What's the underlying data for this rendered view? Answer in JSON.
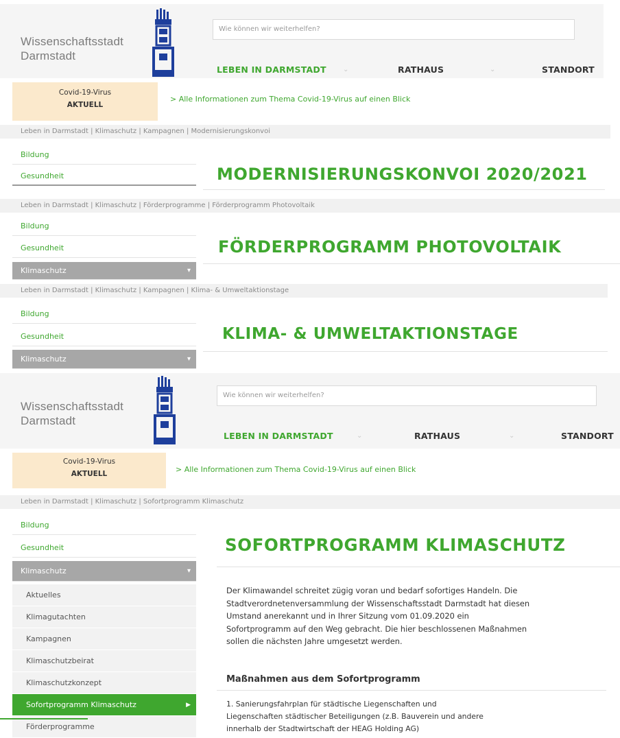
{
  "header": {
    "brand_line1": "Wissenschaftsstadt",
    "brand_line2": "Darmstadt",
    "search_placeholder": "Wie können wir weiterhelfen?",
    "nav": [
      "LEBEN IN DARMSTADT",
      "RATHAUS",
      "STANDORT"
    ]
  },
  "covid": {
    "label_line1": "Covid-19-Virus",
    "label_line2": "AKTUELL",
    "link_text": "> Alle Informationen zum Thema Covid-19-Virus auf einen Blick"
  },
  "panels": {
    "konvoi": {
      "breadcrumb": "Leben in Darmstadt | Klimaschutz | Kampagnen | Modernisierungskonvoi",
      "title": "MODERNISIERUNGSKONVOI 2020/2021"
    },
    "photovoltaik": {
      "breadcrumb": "Leben in Darmstadt | Klimaschutz | Förderprogramme | Förderprogramm Photovoltaik",
      "title": "FÖRDERPROGRAMM PHOTOVOLTAIK"
    },
    "aktionstage": {
      "breadcrumb": "Leben in Darmstadt | Klimaschutz | Kampagnen | Klima- & Umweltaktionstage",
      "title": "KLIMA- & UMWELTAKTIONSTAGE"
    },
    "sofort": {
      "breadcrumb": "Leben in Darmstadt | Klimaschutz | Sofortprogramm Klimaschutz",
      "title": "SOFORTPROGRAMM KLIMASCHUTZ",
      "body_line1": "Der Klimawandel schreitet zügig voran und bedarf sofortiges Handeln. Die",
      "body_line2": "Stadtverordnetenversammlung der Wissenschaftsstadt Darmstadt hat diesen",
      "body_line3": "Umstand anerekannt und in Ihrer Sitzung vom 01.09.2020 ein",
      "body_line4": "Sofortprogramm auf den Weg gebracht. Die hier beschlossenen Maßnahmen",
      "body_line5": "sollen die nächsten Jahre umgesetzt werden.",
      "subheading": "Maßnahmen aus dem Sofortprogramm",
      "item1_line1": "1. Sanierungsfahrplan für städtische Liegenschaften und",
      "item1_line2": "Liegenschaften städtischer Beteiligungen (z.B. Bauverein und andere",
      "item1_line3": "innerhalb der Stadtwirtschaft der HEAG Holding AG)"
    }
  },
  "sidebar": {
    "bildung": "Bildung",
    "gesundheit": "Gesundheit",
    "klimaschutz": "Klimaschutz",
    "sub": [
      "Aktuelles",
      "Klimagutachten",
      "Kampagnen",
      "Klimaschutzbeirat",
      "Klimaschutzkonzept",
      "Sofortprogramm Klimaschutz",
      "Förderprogramme"
    ]
  },
  "colors": {
    "accent_green": "#3fa72f",
    "logo_blue": "#1e3f9c",
    "covid_bg": "#fbe9cc",
    "sidebar_active": "#a7a7a7"
  },
  "icons": {
    "logo": "darmstadt-tower-logo",
    "chevron": "chevron-down-icon",
    "arrow": "chevron-right-icon"
  }
}
